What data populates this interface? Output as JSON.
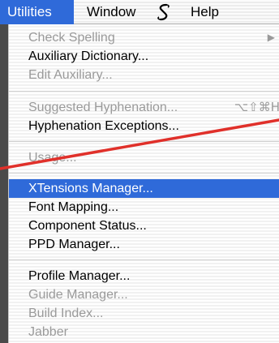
{
  "menubar": {
    "items": [
      {
        "label": "Utilities"
      },
      {
        "label": "Window"
      },
      {
        "label": "Help"
      }
    ],
    "script_icon": "script-icon"
  },
  "menu": {
    "items": [
      {
        "label": "Check Spelling",
        "enabled": false,
        "submenu": true
      },
      {
        "label": "Auxiliary Dictionary...",
        "enabled": true
      },
      {
        "label": "Edit Auxiliary...",
        "enabled": false
      },
      {
        "label": "Suggested Hyphenation...",
        "enabled": false,
        "shortcut": "⌥⇧⌘H"
      },
      {
        "label": "Hyphenation Exceptions...",
        "enabled": true
      },
      {
        "label": "Usage...",
        "enabled": false
      },
      {
        "label": "XTensions Manager...",
        "enabled": true,
        "highlighted": true
      },
      {
        "label": "Font Mapping...",
        "enabled": true
      },
      {
        "label": "Component Status...",
        "enabled": true
      },
      {
        "label": "PPD Manager...",
        "enabled": true
      },
      {
        "label": "Profile Manager...",
        "enabled": true
      },
      {
        "label": "Guide Manager...",
        "enabled": false
      },
      {
        "label": "Build Index...",
        "enabled": false
      },
      {
        "label": "Jabber",
        "enabled": false
      }
    ]
  },
  "colors": {
    "highlight": "#2f6ad9",
    "disabled_text": "#9a9a9a",
    "annotation_line": "#e0302a"
  }
}
